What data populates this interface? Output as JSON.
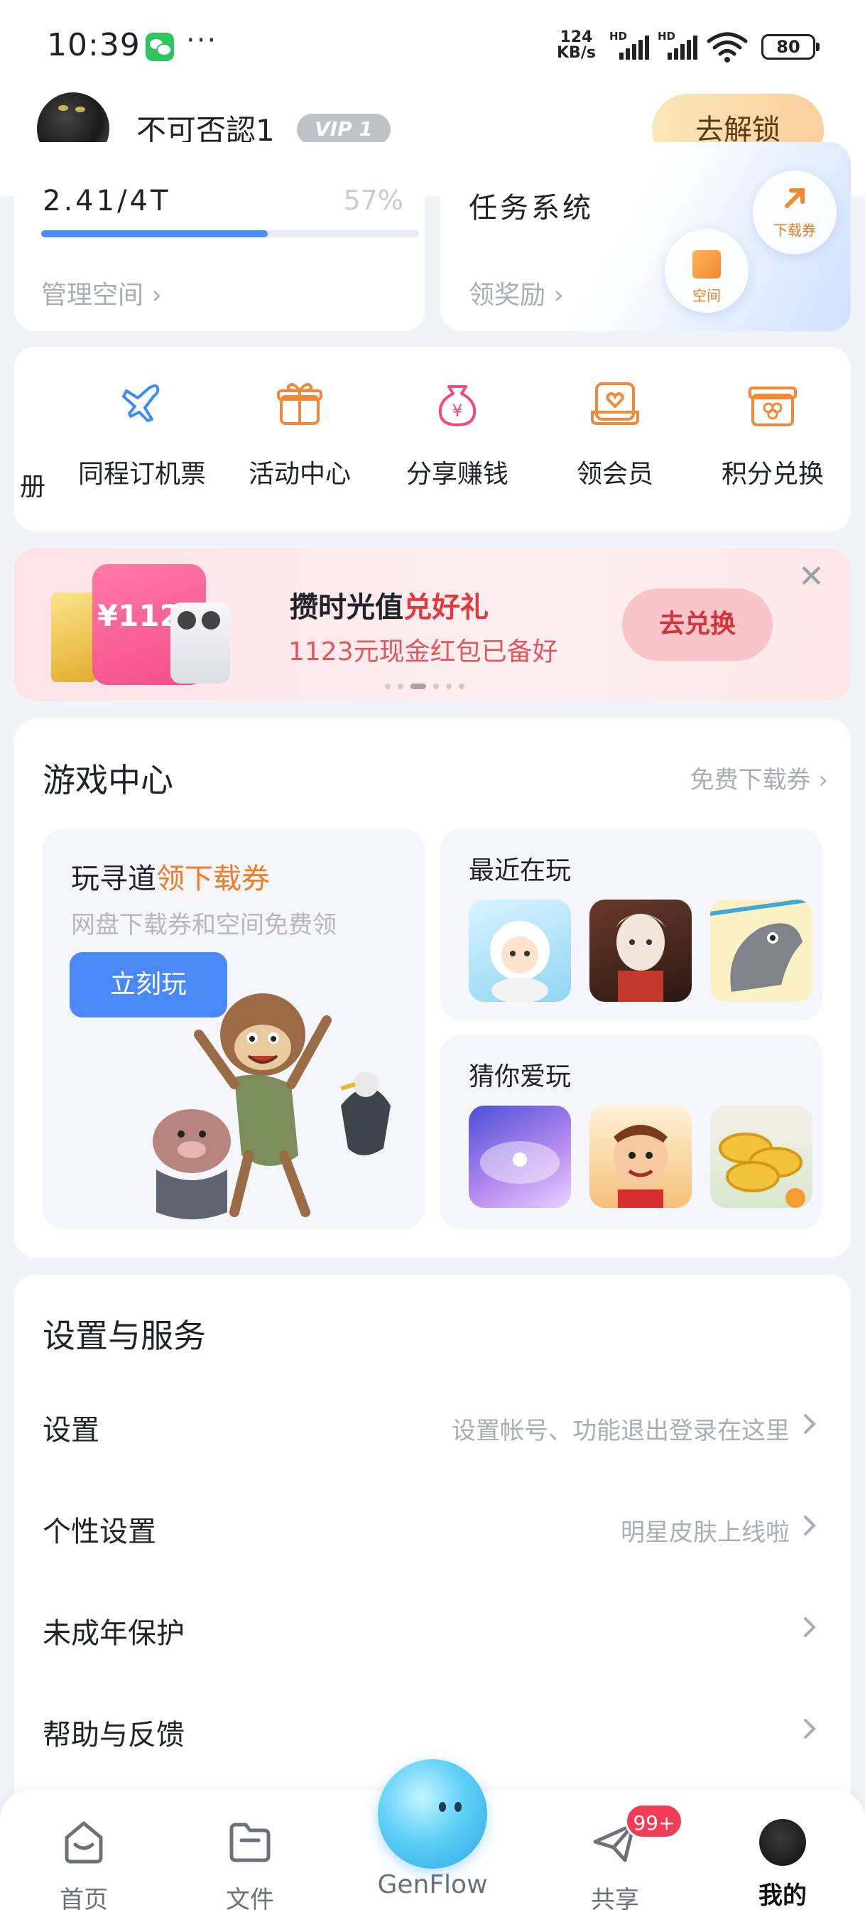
{
  "status_bar": {
    "time": "10:39",
    "speed_value": "124",
    "speed_unit": "KB/s",
    "sim1": "HD",
    "sim2": "HD",
    "battery": "80"
  },
  "profile": {
    "username": "不可否認1",
    "vip": "VIP 1",
    "unlock_label": "去解锁"
  },
  "storage": {
    "usage_text": "2.41/4T",
    "percent_text": "57%",
    "used_fraction": 0.6,
    "manage_label": "管理空间"
  },
  "tasks": {
    "title_text": "任务系统",
    "reward_label": "领奖励",
    "bubble_download": "下载券",
    "bubble_space": "空间"
  },
  "quick_links": [
    {
      "label": "册",
      "icon": "album-icon"
    },
    {
      "label": "同程订机票",
      "icon": "airplane-icon"
    },
    {
      "label": "活动中心",
      "icon": "gift-box-icon"
    },
    {
      "label": "分享赚钱",
      "icon": "money-bag-icon"
    },
    {
      "label": "领会员",
      "icon": "member-card-icon"
    },
    {
      "label": "积分兑换",
      "icon": "points-gift-icon"
    }
  ],
  "banner": {
    "amount": "¥1123",
    "title_prefix": "攒时光值",
    "title_highlight": "兑好礼",
    "subtitle": "1123元现金红包已备好",
    "redeem_label": "去兑换",
    "page_count": 6,
    "active_page": 3
  },
  "game_center": {
    "title": "游戏中心",
    "more_label": "免费下载券",
    "featured": {
      "title_prefix": "玩寻道",
      "title_highlight": "领下载券",
      "subtitle": "网盘下载券和空间免费领",
      "play_label": "立刻玩"
    },
    "recent_title": "最近在玩",
    "guess_title": "猜你爱玩"
  },
  "settings": {
    "title": "设置与服务",
    "rows": [
      {
        "label": "设置",
        "hint": "设置帐号、功能退出登录在这里"
      },
      {
        "label": "个性设置",
        "hint": "明星皮肤上线啦"
      },
      {
        "label": "未成年保护",
        "hint": ""
      },
      {
        "label": "帮助与反馈",
        "hint": ""
      }
    ]
  },
  "bottom_nav": {
    "home": "首页",
    "files": "文件",
    "genflow": "GenFlow",
    "share": "共享",
    "share_badge": "99+",
    "me": "我的"
  },
  "colors": {
    "accent_blue": "#4a88f6",
    "orange": "#f07c23",
    "red": "#e4393c"
  }
}
